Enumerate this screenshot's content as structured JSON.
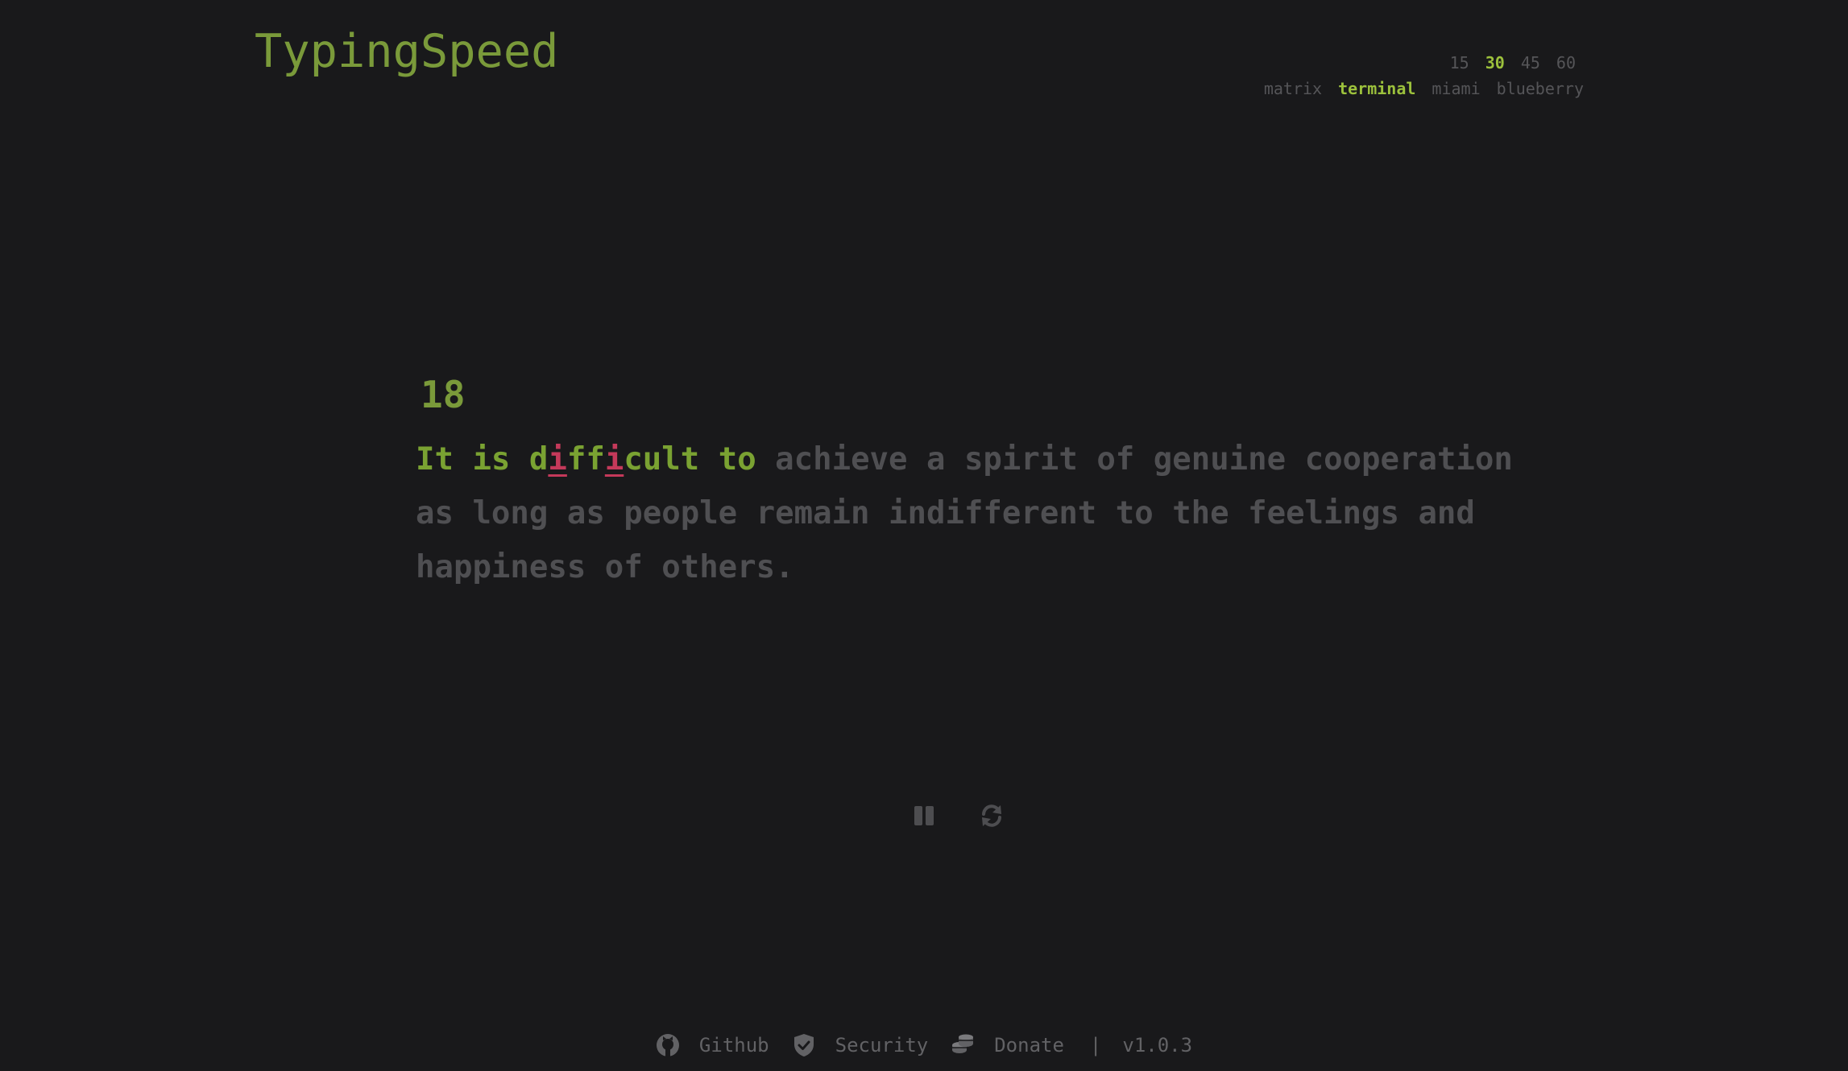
{
  "app": {
    "title": "TypingSpeed"
  },
  "settings": {
    "times": [
      {
        "label": "15",
        "active": false
      },
      {
        "label": "30",
        "active": true
      },
      {
        "label": "45",
        "active": false
      },
      {
        "label": "60",
        "active": false
      }
    ],
    "themes": [
      {
        "label": "matrix",
        "active": false
      },
      {
        "label": "terminal",
        "active": true
      },
      {
        "label": "miami",
        "active": false
      },
      {
        "label": "blueberry",
        "active": false
      }
    ]
  },
  "test": {
    "countdown": "18",
    "segments": [
      {
        "text": "It is d",
        "state": "typed"
      },
      {
        "text": "i",
        "state": "error"
      },
      {
        "text": "ff",
        "state": "typed"
      },
      {
        "text": "i",
        "state": "error"
      },
      {
        "text": "cult to ",
        "state": "typed"
      },
      {
        "text": "achieve a spirit of genuine cooperation as long as people remain indifferent to the feelings and happiness of others.",
        "state": "pending"
      }
    ]
  },
  "controls": {
    "pause_icon": "pause-icon",
    "restart_icon": "refresh-icon"
  },
  "footer": {
    "github_label": "Github",
    "security_label": "Security",
    "donate_label": "Donate",
    "separator": "|",
    "version": "v1.0.3"
  },
  "colors": {
    "background": "#19191b",
    "accent": "#9cc13c",
    "typed": "#7aa232",
    "error": "#c4395a",
    "pending": "#4f4f52"
  }
}
